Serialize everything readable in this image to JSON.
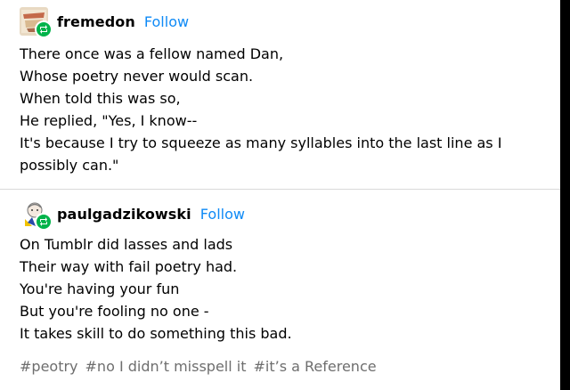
{
  "posts": [
    {
      "username": "fremedon",
      "follow_label": "Follow",
      "lines": [
        "There once was a fellow named Dan,",
        "Whose poetry never would scan.",
        "When told this was so,",
        "He replied, \"Yes, I know--",
        "It's because I try to squeeze as many syllables into the last line as I possibly can.\""
      ]
    },
    {
      "username": "paulgadzikowski",
      "follow_label": "Follow",
      "lines": [
        "On Tumblr did lasses and lads",
        "Their way with fail poetry had.",
        "You're having your fun",
        "But you're fooling no one -",
        "It takes skill to do something this bad."
      ]
    }
  ],
  "tags": [
    "#peotry",
    "#no I didn’t misspell it",
    "#it’s a Reference"
  ],
  "colors": {
    "follow": "#0f8af6",
    "reblog_badge": "#00b34a",
    "tag": "#6e6e6e",
    "divider": "#d9d9d9"
  },
  "icons": {
    "reblog_badge": "reblog-icon"
  }
}
